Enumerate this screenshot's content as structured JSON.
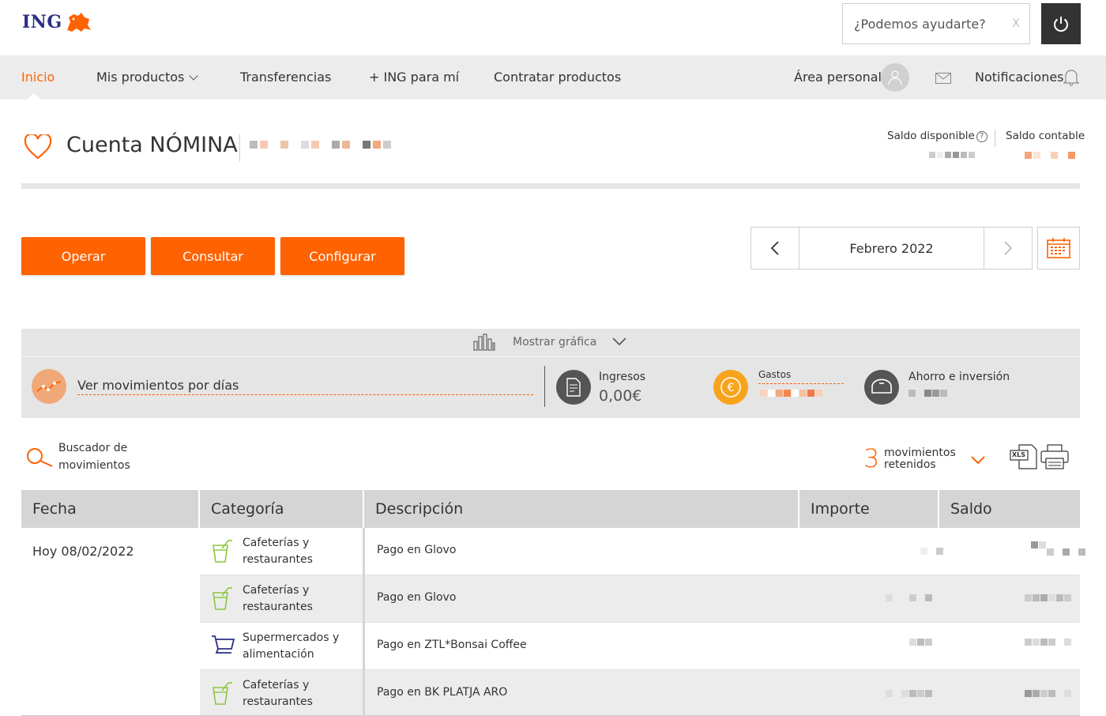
{
  "header": {
    "brand": "ING",
    "help_placeholder": "¿Podemos ayudarte?",
    "help_clear": "X"
  },
  "nav": {
    "items": [
      {
        "label": "Inicio",
        "active": true
      },
      {
        "label": "Mis productos"
      },
      {
        "label": "Transferencias"
      },
      {
        "label": "+ ING para mí"
      },
      {
        "label": "Contratar productos"
      }
    ],
    "area_personal": "Área personal",
    "notifications": "Notificaciones"
  },
  "account": {
    "title": "Cuenta NÓMINA",
    "saldo_disponible": "Saldo disponible",
    "help_mark": "?",
    "saldo_contable": "Saldo contable"
  },
  "actions": {
    "operar": "Operar",
    "consultar": "Consultar",
    "configurar": "Configurar"
  },
  "month_nav": {
    "label": "Febrero 2022"
  },
  "graph": {
    "toggle_label": "Mostrar gráfica"
  },
  "summary": {
    "days_link": "Ver movimientos por días",
    "ingresos_label": "Ingresos",
    "ingresos_value": "0,00€",
    "gastos_label": "Gastos",
    "ahorro_label": "Ahorro e inversión"
  },
  "tools": {
    "search_label": "Buscador de movimientos",
    "retained_count": "3",
    "retained_label": "movimientos retenidos",
    "xls_label": "XLS"
  },
  "table": {
    "headers": [
      "Fecha",
      "Categoría",
      "Descripción",
      "Importe",
      "Saldo"
    ],
    "date": "Hoy  08/02/2022",
    "rows": [
      {
        "category": "Cafeterías y restaurantes",
        "icon": "drink-icon",
        "description": "Pago en Glovo"
      },
      {
        "category": "Cafeterías y restaurantes",
        "icon": "drink-icon",
        "description": "Pago en Glovo"
      },
      {
        "category": "Supermercados y alimentación",
        "icon": "cart-icon",
        "description": "Pago en ZTL*Bonsai Coffee"
      },
      {
        "category": "Cafeterías y restaurantes",
        "icon": "drink-icon",
        "description": "Pago en BK PLATJA ARO"
      }
    ]
  },
  "colors": {
    "brand_orange": "#ff6200",
    "brand_blue": "#2b2f86",
    "nav_bg": "#ececec",
    "panel_bg": "#e5e5e5"
  }
}
